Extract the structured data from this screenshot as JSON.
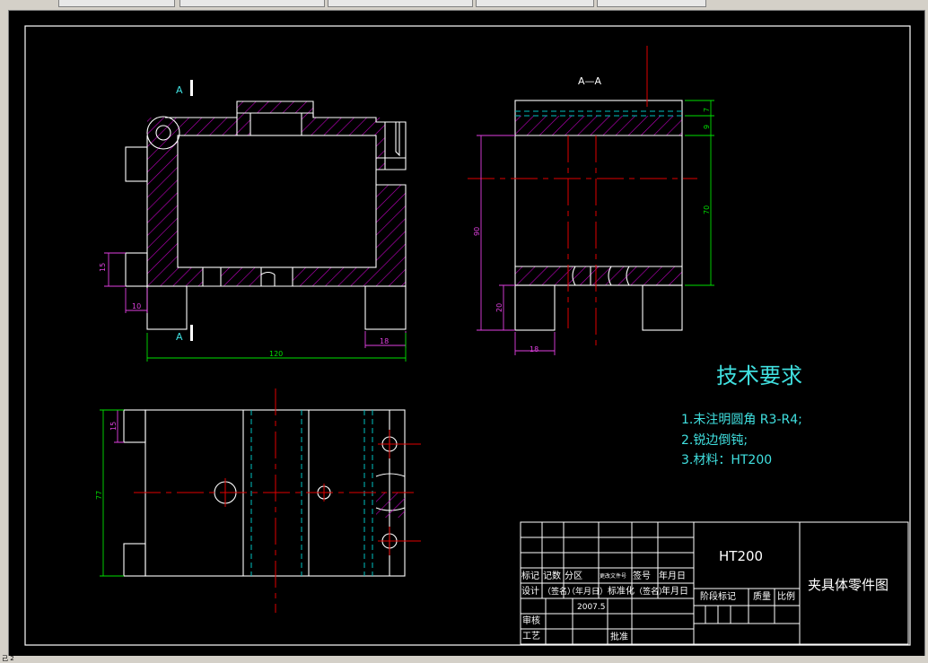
{
  "drawing": {
    "section_label_a": "A",
    "section_label_aa": "A—A",
    "dims_front": {
      "d15": "15",
      "d10": "10",
      "d120": "120",
      "d18": "18"
    },
    "dims_side": {
      "d7": "7",
      "d9": "9",
      "d70": "70",
      "d90": "90",
      "d20": "20",
      "d18": "18"
    },
    "dims_top": {
      "d15": "15",
      "d77": "77"
    }
  },
  "tech": {
    "title": "技术要求",
    "items": [
      "1.未注明圆角 R3-R4;",
      "2.锐边倒钝;",
      "3.材料：HT200"
    ]
  },
  "titleblock": {
    "material": "HT200",
    "name": "夹具体零件图",
    "row1": [
      "标记",
      "记数",
      "分区",
      "更改文件号",
      "签号",
      "年月日"
    ],
    "row2": [
      "设计",
      "（签名）",
      "（年月日）",
      "标准化",
      "（签名）",
      "年月日"
    ],
    "date": "2007.5",
    "stage": "阶段标记",
    "mass": "质量",
    "scale": "比例",
    "review": "审核",
    "process": "工艺",
    "approve": "批准"
  },
  "status": {
    "text": "己 2"
  },
  "colors": {
    "bg": "#000000",
    "outline": "#ffffff",
    "hatch": "#c000c0",
    "dim_magenta": "#e040e0",
    "dim_green": "#00e000",
    "center": "#e00000",
    "hidden": "#00c0c0",
    "text": "#40e0e0"
  }
}
